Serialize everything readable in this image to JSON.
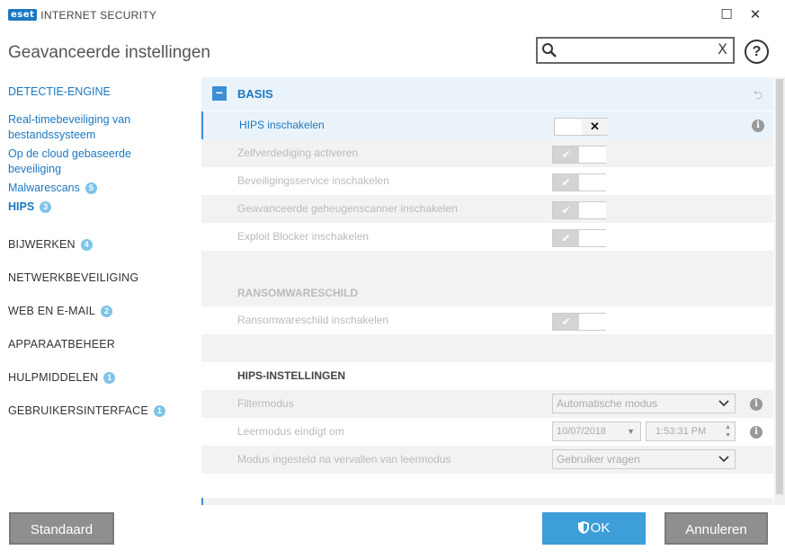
{
  "window": {
    "logo": "eset",
    "product": "INTERNET SECURITY",
    "minimize_icon": "maximize-icon",
    "close_icon": "close-icon"
  },
  "header": {
    "title": "Geavanceerde instellingen",
    "search": {
      "value": "",
      "placeholder": "",
      "clear": "X"
    },
    "help": "?"
  },
  "sidebar": {
    "items": [
      {
        "label": "DETECTIE-ENGINE",
        "badge": ""
      },
      {
        "label": "Real-timebeveiliging van bestandssysteem",
        "badge": ""
      },
      {
        "label": "Op de cloud gebaseerde beveiliging",
        "badge": ""
      },
      {
        "label": "Malwarescans",
        "badge": "5"
      },
      {
        "label": "HIPS",
        "badge": "3"
      },
      {
        "label": "BIJWERKEN",
        "badge": "4"
      },
      {
        "label": "NETWERKBEVEILIGING",
        "badge": ""
      },
      {
        "label": "WEB EN E-MAIL",
        "badge": "2"
      },
      {
        "label": "APPARAATBEHEER",
        "badge": ""
      },
      {
        "label": "HULPMIDDELEN",
        "badge": "1"
      },
      {
        "label": "GEBRUIKERSINTERFACE",
        "badge": "1"
      }
    ]
  },
  "main": {
    "section_title": "BASIS",
    "basis_rows": [
      {
        "label": "HIPS inschakelen",
        "state": "off"
      },
      {
        "label": "Zelfverdediging activeren",
        "state": "on"
      },
      {
        "label": "Beveiligingsservice inschakelen",
        "state": "on"
      },
      {
        "label": "Geavanceerde geheugenscanner inschakelen",
        "state": "on"
      },
      {
        "label": "Exploit Blocker inschakelen",
        "state": "on"
      }
    ],
    "ransomware": {
      "title": "RANSOMWARESCHILD",
      "row_label": "Ransomwareschild inschakelen"
    },
    "hips_settings": {
      "title": "HIPS-INSTELLINGEN",
      "filter_label": "Filtermodus",
      "filter_value": "Automatische modus",
      "learn_label": "Leermodus eindigt om",
      "learn_date": "10/07/2018",
      "learn_time": "1:53:31 PM",
      "after_label": "Modus ingesteld na vervallen van leermodus",
      "after_value": "Gebruiker vragen"
    },
    "toggle_off_glyph": "✕",
    "toggle_on_glyph": "✔"
  },
  "footer": {
    "default_label": "Standaard",
    "ok_label": "OK",
    "cancel_label": "Annuleren"
  },
  "colors": {
    "accent": "#1b78c2",
    "button_blue": "#3d9ed8",
    "button_gray": "#8f8f8f"
  }
}
